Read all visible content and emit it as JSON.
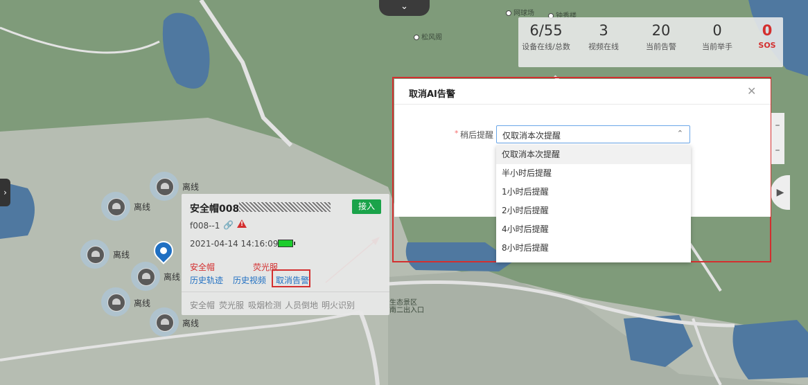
{
  "map": {
    "pois": [
      "网球场",
      "钟秀楼",
      "松风阁",
      "生态景区",
      "南二出入口"
    ],
    "offline_label": "离线"
  },
  "top_toggle_icon": "chevron-down-icon",
  "stats": [
    {
      "value": "6/55",
      "label": "设备在线/总数"
    },
    {
      "value": "3",
      "label": "视频在线"
    },
    {
      "value": "20",
      "label": "当前告警"
    },
    {
      "value": "0",
      "label": "当前举手"
    },
    {
      "value": "0",
      "label": "SOS",
      "color": "#d32f2f"
    }
  ],
  "popup": {
    "title": "安全帽008",
    "join_label": "接入",
    "device_id": "f008--1",
    "timestamp": "2021-04-14 14:16:09",
    "battery_level": 1.0,
    "alarms": [
      "安全帽",
      "荧光服"
    ],
    "actions": [
      "历史轨迹",
      "历史视频",
      "取消告警"
    ],
    "tags": [
      "安全帽",
      "荧光服",
      "吸烟检测",
      "人员倒地",
      "明火识别"
    ]
  },
  "modal": {
    "title": "取消AI告警",
    "required_mark": "*",
    "field_label": "稍后提醒",
    "selected": "仅取消本次提醒",
    "options": [
      "仅取消本次提醒",
      "半小时后提醒",
      "1小时后提醒",
      "2小时后提醒",
      "4小时后提醒",
      "8小时后提醒"
    ]
  },
  "colors": {
    "accent_red": "#d32f2f",
    "link_blue": "#1f6fc2",
    "join_green": "#1aa34a"
  }
}
